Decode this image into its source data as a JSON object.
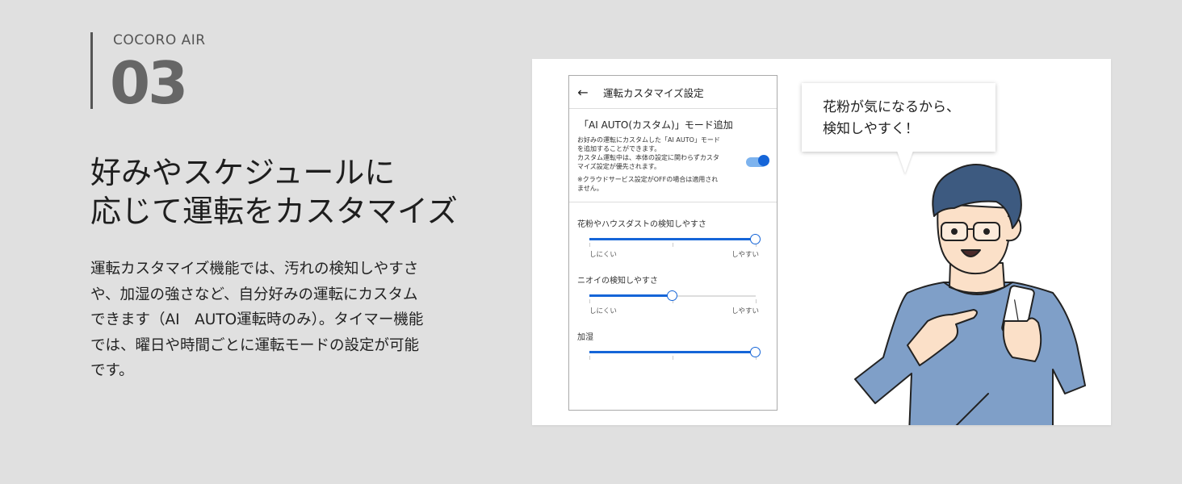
{
  "brand": "COCORO AIR",
  "number": "03",
  "headline": [
    "好みやスケジュールに",
    "応じて運転をカスタマイズ"
  ],
  "body_lines": [
    "運転カスタマイズ機能では、汚れの検知しやすさ",
    "や、加湿の強さなど、自分好みの運転にカスタム",
    "できます（AI　AUTO運転時のみ）。タイマー機能",
    "では、曜日や時間ごとに運転モードの設定が可能",
    "です。"
  ],
  "phone": {
    "back_icon": "back-arrow-icon",
    "title": "運転カスタマイズ設定",
    "mode": {
      "title": "「AI AUTO(カスタム)」モード追加",
      "description": "お好みの運転にカスタムした「AI AUTO」モード\nを追加することができます。\nカスタム運転中は、本体の設定に関わらずカスタ\nマイズ設定が優先されます。",
      "note": "※クラウドサービス設定がOFFの場合は適用され\nません。",
      "toggle_on": true
    },
    "sliders": [
      {
        "label": "花粉やハウスダストの検知しやすさ",
        "value": 1.0,
        "min_label": "しにくい",
        "max_label": "しやすい"
      },
      {
        "label": "ニオイの検知しやすさ",
        "value": 0.5,
        "min_label": "しにくい",
        "max_label": "しやすい"
      },
      {
        "label": "加湿",
        "value": 1.0,
        "min_label": "",
        "max_label": ""
      }
    ]
  },
  "bubble": {
    "line1": "花粉が気になるから、",
    "line2": "検知しやすく！"
  },
  "colors": {
    "background": "#e0e0e0",
    "accent": "#1565d8",
    "shirt": "#7f9fc8",
    "hair": "#3d5a80",
    "skin": "#fbe0c8"
  }
}
